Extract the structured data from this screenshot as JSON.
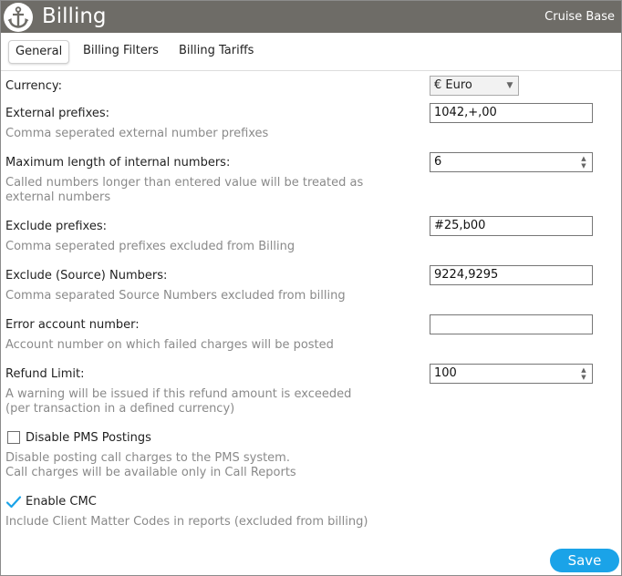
{
  "app": {
    "title": "Billing",
    "site": "Cruise Base",
    "logo_icon": "anchor-icon"
  },
  "tabs": [
    {
      "label": "General",
      "active": true
    },
    {
      "label": "Billing Filters",
      "active": false
    },
    {
      "label": "Billing Tariffs",
      "active": false
    }
  ],
  "settings": {
    "currency": {
      "label": "Currency:",
      "value": "€ Euro"
    },
    "external_prefixes": {
      "label": "External prefixes:",
      "hint": "Comma seperated external number prefixes",
      "value": "1042,+,00"
    },
    "max_length": {
      "label": "Maximum length of internal numbers:",
      "hint": "Called numbers longer than entered value will be treated as\nexternal numbers",
      "value": "6"
    },
    "exclude_prefixes": {
      "label": "Exclude prefixes:",
      "hint": "Comma seperated prefixes excluded from Billing",
      "value": "#25,b00"
    },
    "exclude_source": {
      "label": "Exclude (Source) Numbers:",
      "hint": "Comma separated Source Numbers excluded from billing",
      "value": "9224,9295"
    },
    "error_account": {
      "label": "Error account number:",
      "hint": "Account number on which failed charges will be posted",
      "value": ""
    },
    "refund_limit": {
      "label": "Refund Limit:",
      "hint": "A warning will be issued if this refund amount is exceeded\n(per transaction in a defined currency)",
      "value": "100"
    },
    "disable_pms": {
      "label": "Disable PMS Postings",
      "hint": "Disable posting call charges to the PMS system.\nCall charges will be available only in Call Reports",
      "checked": false
    },
    "enable_cmc": {
      "label": "Enable CMC",
      "hint": "Include Client Matter Codes in reports (excluded from billing)",
      "checked": true
    }
  },
  "actions": {
    "save_label": "Save"
  },
  "colors": {
    "titlebar": "#6e6c67",
    "accent": "#1aa3e8",
    "hint": "#8a8a8a"
  }
}
